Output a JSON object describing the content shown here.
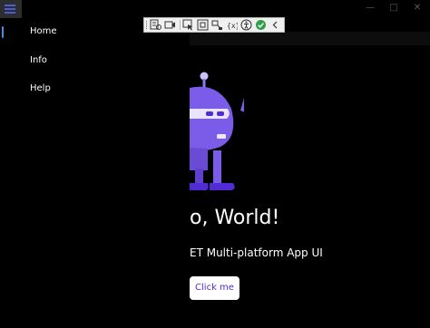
{
  "window": {
    "controls": {
      "minimize_glyph": "—",
      "maximize_glyph": "□",
      "close_glyph": "✕"
    }
  },
  "menu_toggle": {
    "icon": "hamburger-icon"
  },
  "dev_toolbar": {
    "icons": [
      "go-to-live-visual-tree-icon",
      "select-element-icon",
      "display-layout-adorners-icon",
      "track-focused-element-icon",
      "binding-failures-icon",
      "scan-accessibility-icon",
      "accessibility-ok-icon",
      "collapse-toolbar-icon"
    ]
  },
  "nav": {
    "items": [
      {
        "label": "Home",
        "selected": true
      },
      {
        "label": "Info",
        "selected": false
      },
      {
        "label": "Help",
        "selected": false
      }
    ]
  },
  "main": {
    "headline": "o, World!",
    "subtitle": "ET Multi-platform App UI",
    "button_label": "Click me",
    "image_name": "dotnet-bot"
  },
  "colors": {
    "background": "#000000",
    "accent": "#512bd4",
    "bot_purple": "#7b5ce8",
    "selection_indicator": "#4a8de0"
  }
}
